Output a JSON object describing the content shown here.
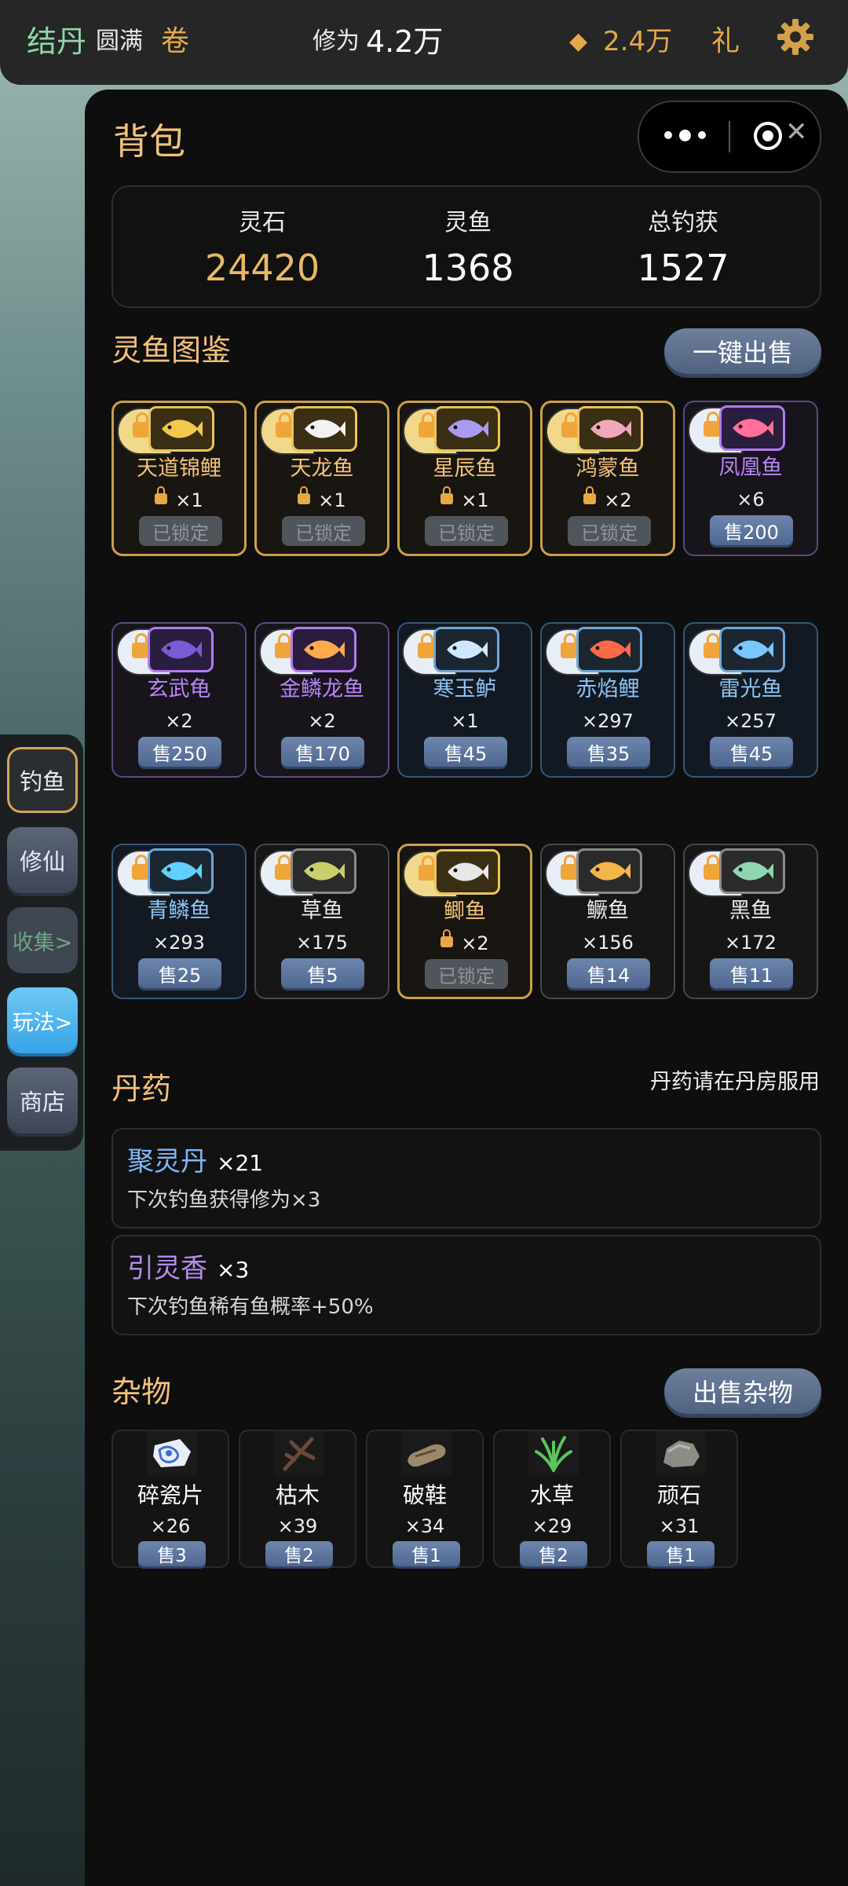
{
  "topbar": {
    "realm": "结丹",
    "realm_stage": "圆满",
    "juan_label": "卷",
    "xiuwei_label": "修为",
    "xiuwei_value": "4.2万",
    "gem_icon": "diamond-icon",
    "gem_value": "2.4万",
    "gift_label": "礼",
    "settings_icon": "gear-icon"
  },
  "sidebar": {
    "items": [
      {
        "label": "钓鱼",
        "state": "active"
      },
      {
        "label": "修仙",
        "state": "normal"
      },
      {
        "label": "收集>",
        "state": "disabled"
      },
      {
        "label": "玩法>",
        "state": "highlight"
      },
      {
        "label": "商店",
        "state": "normal"
      }
    ]
  },
  "panel": {
    "title": "背包",
    "stats": [
      {
        "label": "灵石",
        "value": "24420"
      },
      {
        "label": "灵鱼",
        "value": "1368"
      },
      {
        "label": "总钓获",
        "value": "1527"
      }
    ]
  },
  "fish_section": {
    "title": "灵鱼图鉴",
    "sell_all_label": "一键出售",
    "fish": [
      {
        "name": "天道锦鲤",
        "count": "×1",
        "locked": true,
        "button": "已锁定",
        "rarity": "legend",
        "color": "#f2c94c"
      },
      {
        "name": "天龙鱼",
        "count": "×1",
        "locked": true,
        "button": "已锁定",
        "rarity": "legend",
        "color": "#f2f2f2"
      },
      {
        "name": "星辰鱼",
        "count": "×1",
        "locked": true,
        "button": "已锁定",
        "rarity": "legend",
        "color": "#a99cf0"
      },
      {
        "name": "鸿蒙鱼",
        "count": "×2",
        "locked": true,
        "button": "已锁定",
        "rarity": "legend",
        "color": "#f0a8b8"
      },
      {
        "name": "凤凰鱼",
        "count": "×6",
        "locked": false,
        "button": "售200",
        "rarity": "epic",
        "color": "#ff6f9a"
      },
      {
        "name": "玄武龟",
        "count": "×2",
        "locked": false,
        "button": "售250",
        "rarity": "epic",
        "color": "#7a5bd6"
      },
      {
        "name": "金鳞龙鱼",
        "count": "×2",
        "locked": false,
        "button": "售170",
        "rarity": "epic",
        "color": "#ffa94d"
      },
      {
        "name": "寒玉鲈",
        "count": "×1",
        "locked": false,
        "button": "售45",
        "rarity": "rare",
        "color": "#cfe8ff"
      },
      {
        "name": "赤焰鲤",
        "count": "×297",
        "locked": false,
        "button": "售35",
        "rarity": "rare",
        "color": "#ff6b4a"
      },
      {
        "name": "雷光鱼",
        "count": "×257",
        "locked": false,
        "button": "售45",
        "rarity": "rare",
        "color": "#79c7ff"
      },
      {
        "name": "青鳞鱼",
        "count": "×293",
        "locked": false,
        "button": "售25",
        "rarity": "rare",
        "color": "#5fd0ff"
      },
      {
        "name": "草鱼",
        "count": "×175",
        "locked": false,
        "button": "售5",
        "rarity": "common",
        "color": "#c9cf6a"
      },
      {
        "name": "鲫鱼",
        "count": "×2",
        "locked": true,
        "button": "已锁定",
        "rarity": "legend",
        "color": "#e8e8e8"
      },
      {
        "name": "鳜鱼",
        "count": "×156",
        "locked": false,
        "button": "售14",
        "rarity": "common",
        "color": "#f3b64a"
      },
      {
        "name": "黑鱼",
        "count": "×172",
        "locked": false,
        "button": "售11",
        "rarity": "common",
        "color": "#8fd6b0"
      }
    ]
  },
  "elixir_section": {
    "title": "丹药",
    "note": "丹药请在丹房服用",
    "items": [
      {
        "name": "聚灵丹",
        "count": "×21",
        "desc": "下次钓鱼获得修为×3",
        "color": "#7fb8f5"
      },
      {
        "name": "引灵香",
        "count": "×3",
        "desc": "下次钓鱼稀有鱼概率+50%",
        "color": "#b48cf0"
      }
    ]
  },
  "misc_section": {
    "title": "杂物",
    "sell_label": "出售杂物",
    "items": [
      {
        "name": "碎瓷片",
        "count": "×26",
        "button": "售3",
        "icon": "porcelain-shard-icon"
      },
      {
        "name": "枯木",
        "count": "×39",
        "button": "售2",
        "icon": "dead-wood-icon"
      },
      {
        "name": "破鞋",
        "count": "×34",
        "button": "售1",
        "icon": "old-shoe-icon"
      },
      {
        "name": "水草",
        "count": "×29",
        "button": "售2",
        "icon": "water-weed-icon"
      },
      {
        "name": "顽石",
        "count": "×31",
        "button": "售1",
        "icon": "stone-icon"
      }
    ]
  }
}
